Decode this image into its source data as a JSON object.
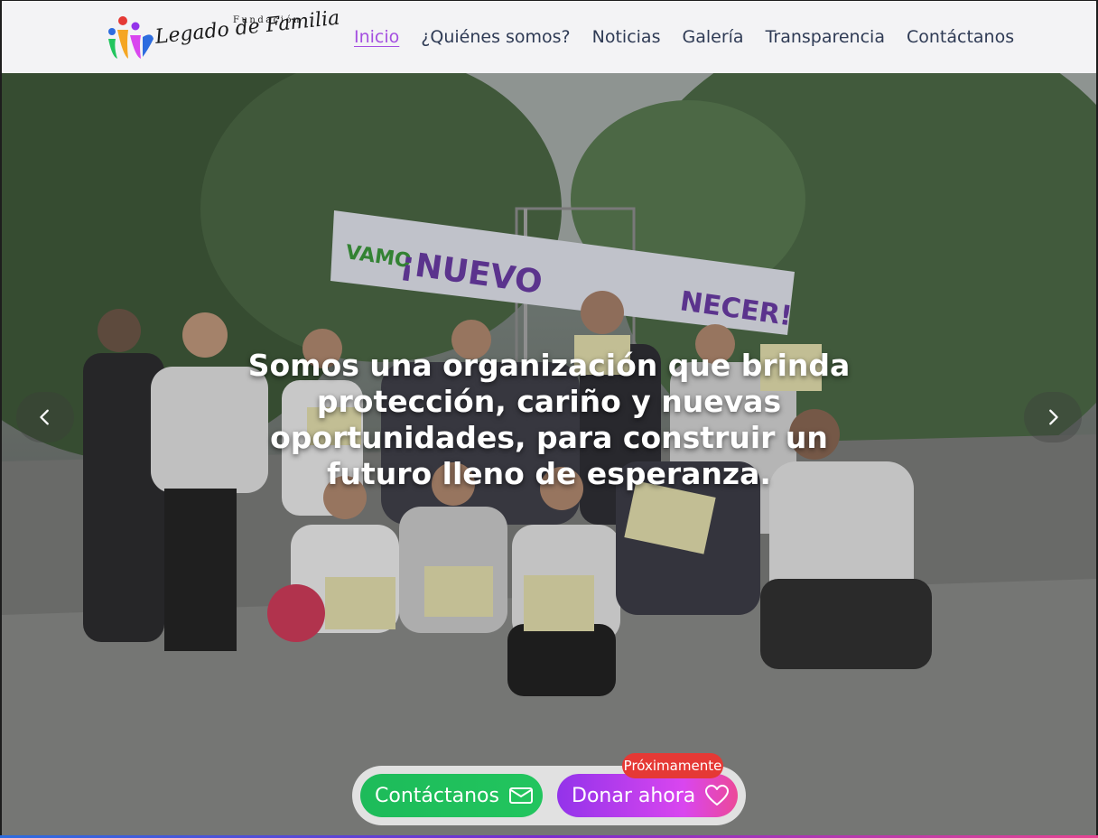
{
  "brand": {
    "small_text": "Fundación",
    "script_text": "Legado de Familia",
    "colors": [
      "#e53935",
      "#2d6cdf",
      "#22c55e",
      "#9333ea"
    ]
  },
  "nav": {
    "items": [
      {
        "label": "Inicio",
        "active": true
      },
      {
        "label": "¿Quiénes somos?",
        "active": false
      },
      {
        "label": "Noticias",
        "active": false
      },
      {
        "label": "Galería",
        "active": false
      },
      {
        "label": "Transparencia",
        "active": false
      },
      {
        "label": "Contáctanos",
        "active": false
      }
    ],
    "active_color": "#a44fe0",
    "text_color": "#2f3b55"
  },
  "hero": {
    "headline": "Somos una organización que brinda protección, cariño y nuevas oportunidades, para construir un futuro lleno de esperanza.",
    "banner_text": "VAMO ¡NUEVO AMANECER!",
    "prev_icon": "chevron-left-icon",
    "next_icon": "chevron-right-icon"
  },
  "cta": {
    "contact_label": "Contáctanos",
    "contact_icon": "mail-icon",
    "contact_color": "#22c55e",
    "donate_label": "Donar ahora",
    "donate_icon": "heart-icon",
    "donate_color": "#9333ea",
    "badge_label": "Próximamente",
    "badge_color": "#e53935"
  }
}
